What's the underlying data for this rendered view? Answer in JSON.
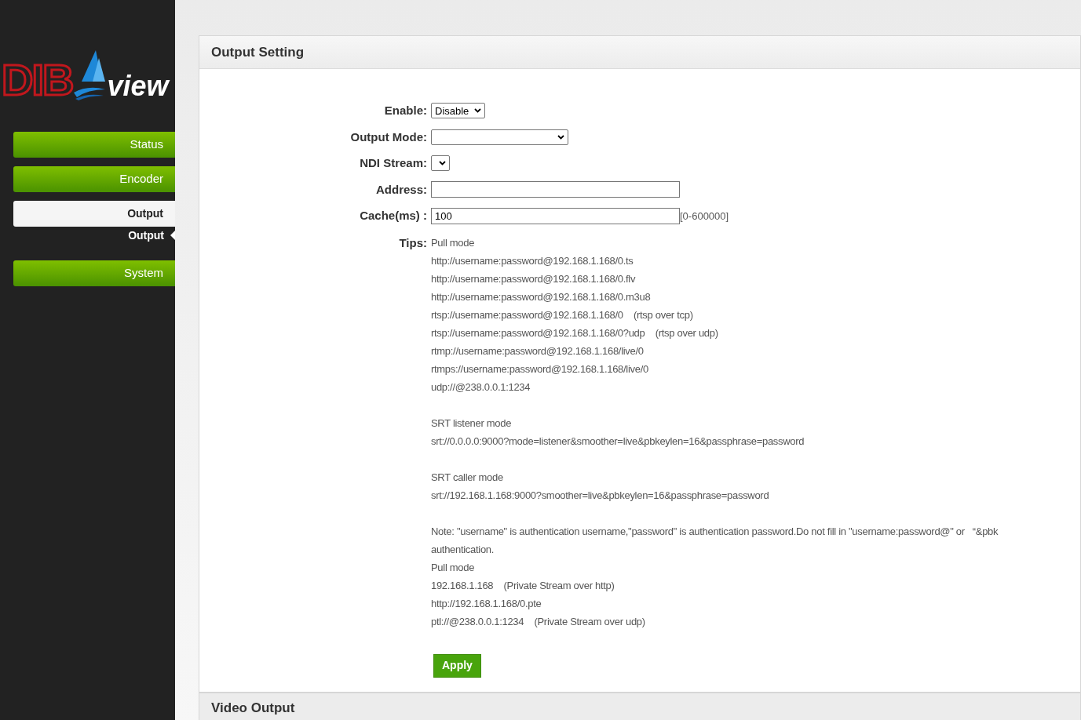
{
  "logo": {
    "brand": "DIB",
    "suffix": "view"
  },
  "nav": [
    {
      "label": "Status",
      "selected": false
    },
    {
      "label": "Encoder",
      "selected": false
    },
    {
      "label": "Output",
      "selected": true,
      "children": [
        {
          "label": "Output",
          "selected": true
        }
      ]
    },
    {
      "label": "System",
      "selected": false
    }
  ],
  "panel": {
    "title": "Output Setting",
    "fields": [
      {
        "kind": "select",
        "label": "Enable:",
        "value": "Disable"
      },
      {
        "kind": "select",
        "label": "Output Mode:"
      },
      {
        "kind": "select",
        "label": "NDI Stream:"
      },
      {
        "kind": "input",
        "label": "Address:"
      },
      {
        "kind": "input",
        "label": "Cache(ms) :",
        "value": "100",
        "hint": "[0-600000]"
      }
    ],
    "tips_label": "Tips:",
    "tips": [
      [
        "Pull mode",
        "http://username:password@192.168.1.168/0.ts",
        "http://username:password@192.168.1.168/0.flv",
        "http://username:password@192.168.1.168/0.m3u8",
        "rtsp://username:password@192.168.1.168/0    (rtsp over tcp)",
        "rtsp://username:password@192.168.1.168/0?udp    (rtsp over udp)",
        "rtmp://username:password@192.168.1.168/live/0",
        "rtmps://username:password@192.168.1.168/live/0",
        "udp://@238.0.0.1:1234"
      ],
      [
        "SRT listener mode",
        "srt://0.0.0.0:9000?mode=listener&smoother=live&pbkeylen=16&passphrase=password"
      ],
      [
        "SRT caller mode",
        "srt://192.168.1.168:9000?smoother=live&pbkeylen=16&passphrase=password"
      ],
      [
        "Note: \"username\" is authentication username,\"password\" is authentication password.Do not fill in \"username:password@\" or   “&pbk",
        "authentication.",
        "Pull mode",
        "192.168.1.168    (Private Stream over http)",
        "http://192.168.1.168/0.pte",
        "ptl://@238.0.0.1:1234    (Private Stream over udp)"
      ]
    ],
    "apply": "Apply"
  },
  "next_panel": {
    "title": "Video Output"
  }
}
